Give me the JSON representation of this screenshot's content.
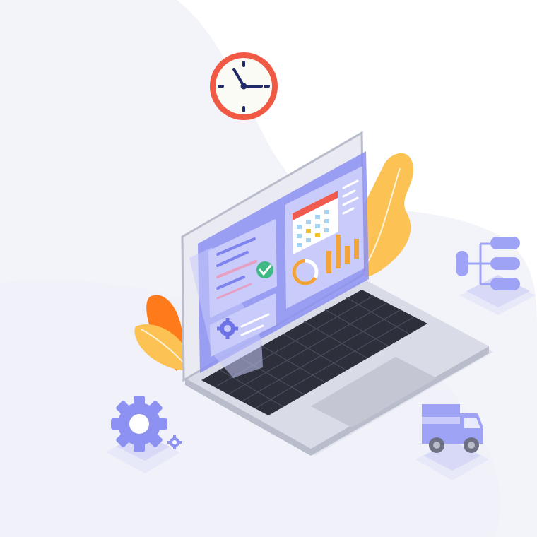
{
  "colors": {
    "background": "#ffffff",
    "blob": "#f3f4fa",
    "blob_light": "#f6f7fb",
    "accent_purple": "#8c91f2",
    "accent_purple_light": "#c9cbfa",
    "clock_ring": "#f05a44",
    "clock_hands": "#1f2a66",
    "leaf_yellow": "#fcc253",
    "leaf_orange": "#ff7a1a",
    "check_green": "#3fb984",
    "calendar_red": "#ef5b4e",
    "chart_orange": "#f2a33a",
    "laptop_body": "#d9dbe6",
    "keyboard": "#2d2f3b"
  },
  "icons": [
    "clock-icon",
    "laptop-icon",
    "dashboard-screen",
    "calendar-icon",
    "bar-chart-icon",
    "donut-chart-icon",
    "check-icon",
    "gear-icon",
    "org-chart-icon",
    "delivery-truck-icon",
    "leaf-decoration"
  ]
}
